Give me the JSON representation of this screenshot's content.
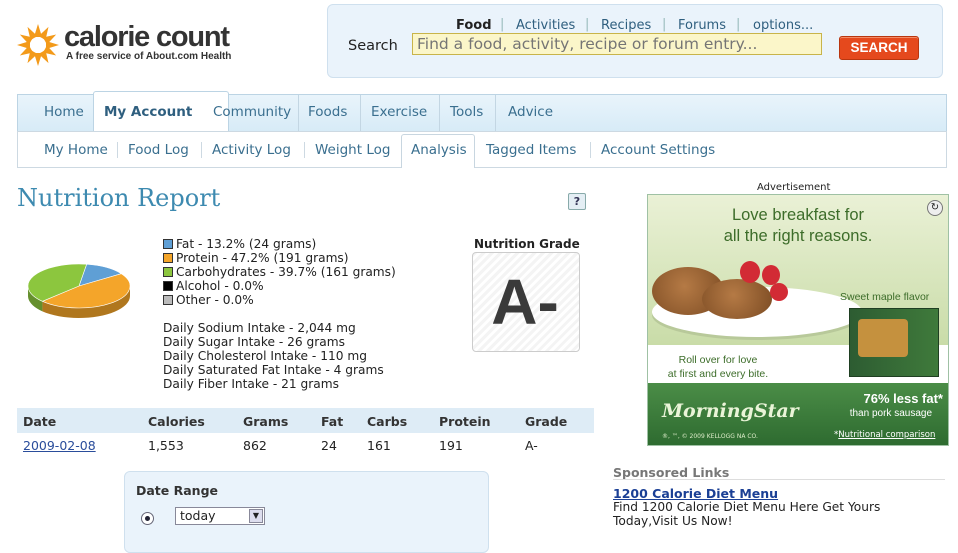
{
  "logo": {
    "name": "calorie count",
    "tagline": "A free service of About.com Health"
  },
  "search": {
    "tabs": [
      "Food",
      "Activities",
      "Recipes",
      "Forums",
      "options..."
    ],
    "label": "Search",
    "placeholder": "Find a food, activity, recipe or forum entry...",
    "button": "SEARCH"
  },
  "nav": {
    "primary": [
      "Home",
      "My Account",
      "Community",
      "Foods",
      "Exercise",
      "Tools",
      "Advice"
    ],
    "primary_active": "My Account",
    "secondary": [
      "My Home",
      "Food Log",
      "Activity Log",
      "Weight Log",
      "Analysis",
      "Tagged Items",
      "Account Settings"
    ],
    "secondary_active": "Analysis"
  },
  "report": {
    "title": "Nutrition Report",
    "help": "?",
    "legend": [
      {
        "label": "Fat - 13.2% (24 grams)",
        "color": "#5f9fd5"
      },
      {
        "label": "Protein - 47.2% (191 grams)",
        "color": "#f4a52a"
      },
      {
        "label": "Carbohydrates - 39.7% (161 grams)",
        "color": "#8cc63e"
      },
      {
        "label": "Alcohol - 0.0%",
        "color": "#000000"
      },
      {
        "label": "Other - 0.0%",
        "color": "#bbbbbb"
      }
    ],
    "intake": [
      "Daily Sodium Intake - 2,044 mg",
      "Daily Sugar Intake - 26 grams",
      "Daily Cholesterol Intake - 110 mg",
      "Daily Saturated Fat Intake - 4 grams",
      "Daily Fiber Intake - 21 grams"
    ],
    "grade_label": "Nutrition Grade",
    "grade": "A-"
  },
  "chart_data": {
    "type": "pie",
    "categories": [
      "Fat",
      "Protein",
      "Carbohydrates",
      "Alcohol",
      "Other"
    ],
    "values": [
      13.2,
      47.2,
      39.7,
      0.0,
      0.0
    ],
    "colors": [
      "#5f9fd5",
      "#f4a52a",
      "#8cc63e",
      "#000000",
      "#bbbbbb"
    ]
  },
  "table": {
    "headers": [
      "Date",
      "Calories",
      "Grams",
      "Fat",
      "Carbs",
      "Protein",
      "Grade"
    ],
    "rows": [
      [
        "2009-02-08",
        "1,553",
        "862",
        "24",
        "161",
        "191",
        "A-"
      ]
    ]
  },
  "date_range": {
    "label": "Date Range",
    "selected": "today"
  },
  "ad": {
    "label": "Advertisement",
    "headline_1": "Love breakfast for",
    "headline_2": "all the right reasons.",
    "sweet": "Sweet maple flavor",
    "roll_1": "Roll over for love",
    "roll_2": "at first and every bite.",
    "brand": "MorningStar",
    "fat_line": "76% less fat*",
    "fat_sub": "than pork sausage",
    "comparison": "Nutritional comparison",
    "fine": "®, ™, © 2009 KELLOGG NA CO."
  },
  "sponsored": {
    "heading": "Sponsored Links",
    "link": "1200 Calorie Diet Menu",
    "description": "Find 1200 Calorie Diet Menu Here Get Yours Today,Visit Us Now!"
  }
}
